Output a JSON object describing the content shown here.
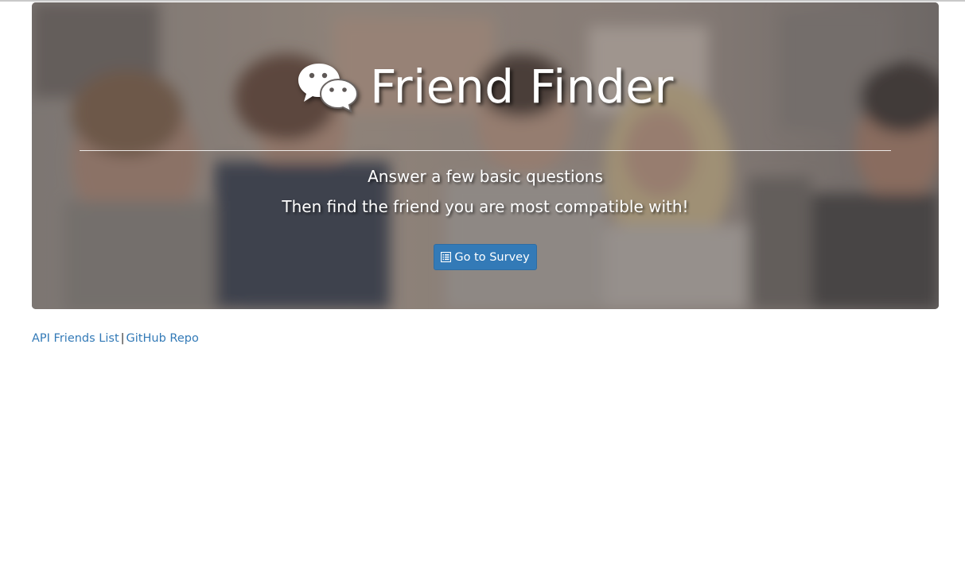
{
  "hero": {
    "title": "Friend Finder",
    "title_icon": "chat-bubbles-icon",
    "subtitle_line1": "Answer a few basic questions",
    "subtitle_line2": "Then find the friend you are most compatible with!",
    "background": "group-of-friends-photo",
    "button": {
      "label": "Go to Survey",
      "icon": "list-icon",
      "color": "#337ab7"
    }
  },
  "footer": {
    "links": [
      {
        "label": "API Friends List"
      },
      {
        "label": "GitHub Repo"
      }
    ],
    "separator": "|",
    "link_color": "#337ab7"
  }
}
